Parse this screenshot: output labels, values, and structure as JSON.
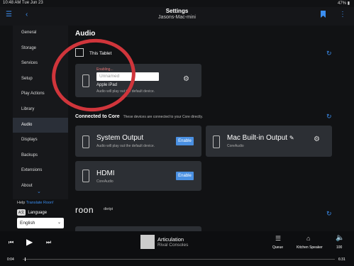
{
  "status": {
    "time": "10:48 AM  Tue Jun 23",
    "battery": "47%"
  },
  "header": {
    "title": "Settings",
    "subtitle": "Jasons-Mac-mini"
  },
  "sidebar": {
    "items": [
      {
        "label": "General"
      },
      {
        "label": "Storage"
      },
      {
        "label": "Services"
      },
      {
        "label": "Setup"
      },
      {
        "label": "Play Actions"
      },
      {
        "label": "Library"
      },
      {
        "label": "Audio"
      },
      {
        "label": "Displays"
      },
      {
        "label": "Backups"
      },
      {
        "label": "Extensions"
      },
      {
        "label": "About"
      }
    ],
    "active": "Audio"
  },
  "help": {
    "prefix": "Help",
    "link": "Translate Roon!"
  },
  "language": {
    "label": "Language",
    "badge": "A文",
    "value": "English"
  },
  "audio": {
    "title": "Audio",
    "this_tablet": {
      "heading": "This Tablet",
      "status": "Enabling...",
      "placeholder": "Unnamed",
      "name": "Apple iPad",
      "desc": "Audio will play out the default device."
    },
    "connected": {
      "heading": "Connected to Core",
      "note": "These devices are connected to your Core directly."
    },
    "system_output": {
      "name": "System Output",
      "desc": "Audio will play out the default device.",
      "button": "Enable"
    },
    "mac_output": {
      "name": "Mac Built-in Output",
      "desc": "CoreAudio"
    },
    "hdmi": {
      "name": "HDMI",
      "desc": "CoreAudio",
      "button": "Enable"
    },
    "roon": {
      "logo": "roon",
      "host": "dietpi"
    }
  },
  "player": {
    "track": "Articulation",
    "artist": "Rival Consoles",
    "time_elapsed": "0:04",
    "time_total": "6:31",
    "queue_label": "Queue",
    "zone_label": "Kitchen Speaker",
    "volume": "100"
  },
  "colors": {
    "accent": "#3b8ef0",
    "enable": "#4a90e2",
    "card": "#2c2f34",
    "annotation": "#d0353b"
  }
}
